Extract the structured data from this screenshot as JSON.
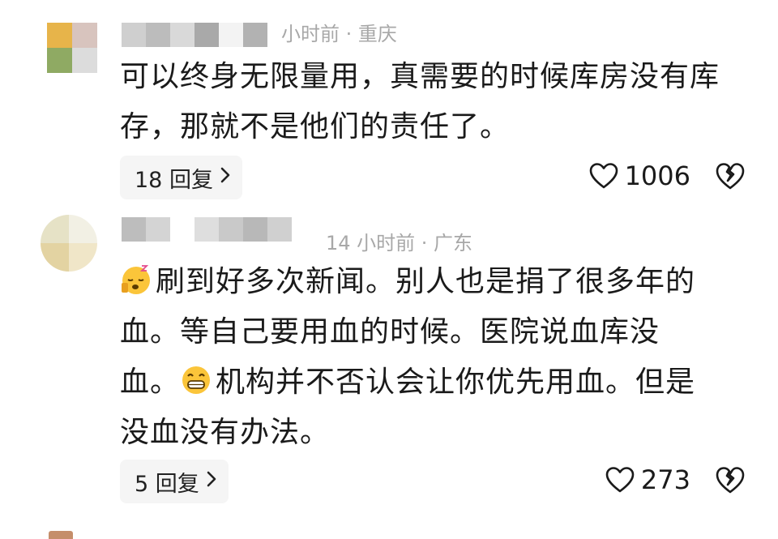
{
  "comments": [
    {
      "meta": "小时前 · 重庆",
      "lines": [
        "可以终身无限量用，真需要的时候库房没有库",
        "存，那就不是他们的责任了。"
      ],
      "reply_label": "18 回复",
      "likes": "1006"
    },
    {
      "meta": "14 小时前 · 广东",
      "line1": "刷到好多次新闻。别人也是捐了很多年的",
      "line2": "血。等自己要用血的时候。医院说血库没",
      "line3_a": "血。",
      "line3_b": "机构并不否认会让你优先用血。但是",
      "line4": "没血没有办法。",
      "reply_label": "5 回复",
      "likes": "273"
    }
  ],
  "icons": {
    "chevron": "chevron-right-icon",
    "like": "heart-outline-icon",
    "dislike": "broken-heart-icon",
    "emoji1": "sleepy-emoji-icon",
    "emoji2": "grinning-emoji-icon"
  },
  "colors": {
    "meta_text": "#a8a8a8",
    "reply_bg": "#f5f5f5"
  }
}
